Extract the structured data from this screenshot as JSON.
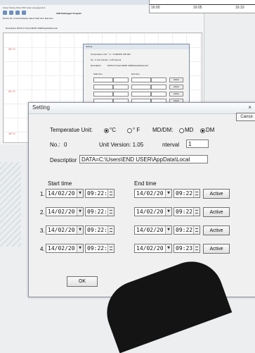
{
  "background": {
    "menu": "Setup  Setting  Show PDF  Help  Language  Exit",
    "app_title": "USB Datalogger Program",
    "fields": "Device No.  Interval  Display  Select               Start time                     End time",
    "description": "Description DATA=C:\\Users\\END USER\\AppData\\Local",
    "axis_labels": [
      "25 °C",
      "20 °C",
      "15 °C"
    ],
    "strip_ticks": [
      "16:00",
      "16:05",
      "16:10"
    ]
  },
  "small_dialog": {
    "title": "Setting",
    "temp_row": "Temperature Unit:   ° C      ° F        MD/DM:    MD    DM",
    "no_row": "No.:  0         Unit Version:  1.05          Interval",
    "desc_label": "Description",
    "desc_value": "DATA=C:\\Users\\END USER\\AppData\\Local",
    "start_hdr": "Start time",
    "end_hdr": "End time",
    "row_date": "14/02/20",
    "row_time": "09:22",
    "active": "Active",
    "ok": "OK",
    "cancel": "Cancel"
  },
  "dialog": {
    "title": "Setting",
    "close": "×",
    "cancel_tab": "Cance",
    "temp_label": "Temperatue Unit:",
    "temp_c": "°C",
    "temp_f": "° F",
    "mddm_label": "MD/DM:",
    "md": "MD",
    "dm": "DM",
    "no_label": "No.:",
    "no_value": "0",
    "unit_version": "Unit Version:  1.05",
    "interval_label": "nterval",
    "interval_value": "1",
    "desc_label": "Descriptior",
    "desc_value": "DATA=C:\\Users\\END USER\\AppData\\Local",
    "start_header": "Start time",
    "end_header": "End time",
    "rows": [
      {
        "num": "1.",
        "start_date": "14/02/20",
        "start_time": "09:22:",
        "end_date": "14/02/20",
        "end_time": "09:22",
        "action": "Active"
      },
      {
        "num": "2.",
        "start_date": "14/02/20",
        "start_time": "09:22:",
        "end_date": "14/02/20",
        "end_time": "09:22",
        "action": "Active"
      },
      {
        "num": "3.",
        "start_date": "14/02/20",
        "start_time": "09:22:",
        "end_date": "14/02/20",
        "end_time": "09:22",
        "action": "Active"
      },
      {
        "num": "4.",
        "start_date": "14/02/20",
        "start_time": "09:22:",
        "end_date": "14/02/20",
        "end_time": "09:23",
        "action": "Active"
      }
    ],
    "ok": "OK"
  }
}
